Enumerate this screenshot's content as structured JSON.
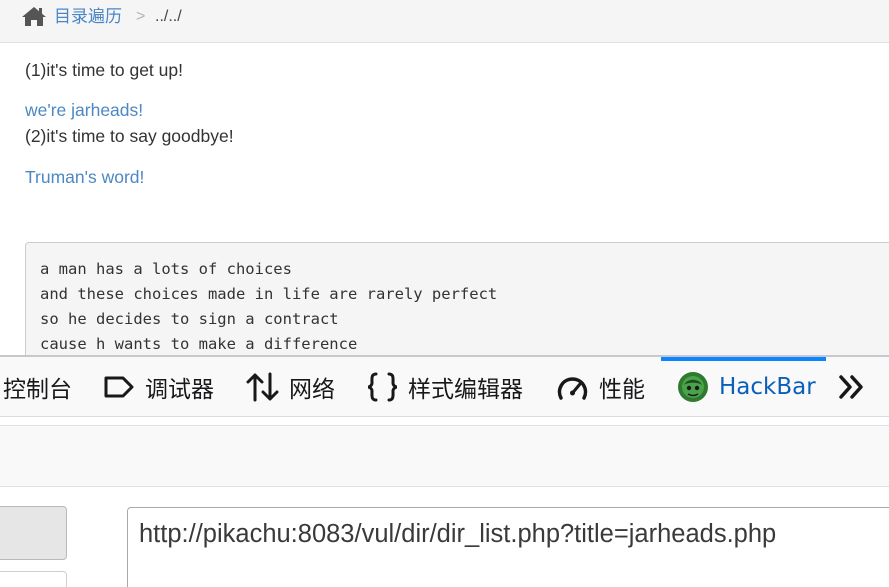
{
  "breadcrumb": {
    "home_icon": "home-icon",
    "link_label": "目录遍历",
    "separator": ">",
    "current": "../../"
  },
  "content": {
    "line1": "(1)it's time to get up!",
    "link1": "we're jarheads!",
    "line2": "(2)it's time to say goodbye!",
    "link2": "Truman's word!",
    "pre_lines": [
      "a man has a lots of choices",
      "and these choices made in life are rarely perfect",
      "so he decides to sign a contract",
      "cause h wants to make a difference"
    ]
  },
  "devtools": {
    "tabs": [
      {
        "label": "控制台",
        "icon": "console-icon"
      },
      {
        "label": "调试器",
        "icon": "debugger-icon"
      },
      {
        "label": "网络",
        "icon": "network-arrows-icon"
      },
      {
        "label": "样式编辑器",
        "icon": "braces-icon"
      },
      {
        "label": "性能",
        "icon": "gauge-icon"
      },
      {
        "label": "HackBar",
        "icon": "hackbar-logo-icon",
        "selected": true
      }
    ],
    "overflow_icon": "double-chevron-icon",
    "url_value": "http://pikachu:8083/vul/dir/dir_list.php?title=jarheads.php"
  },
  "colors": {
    "link": "#4c88c3",
    "selected_tab_text": "#0a5fbb",
    "selected_tab_indicator": "#0a84ff",
    "text": "#333333"
  }
}
